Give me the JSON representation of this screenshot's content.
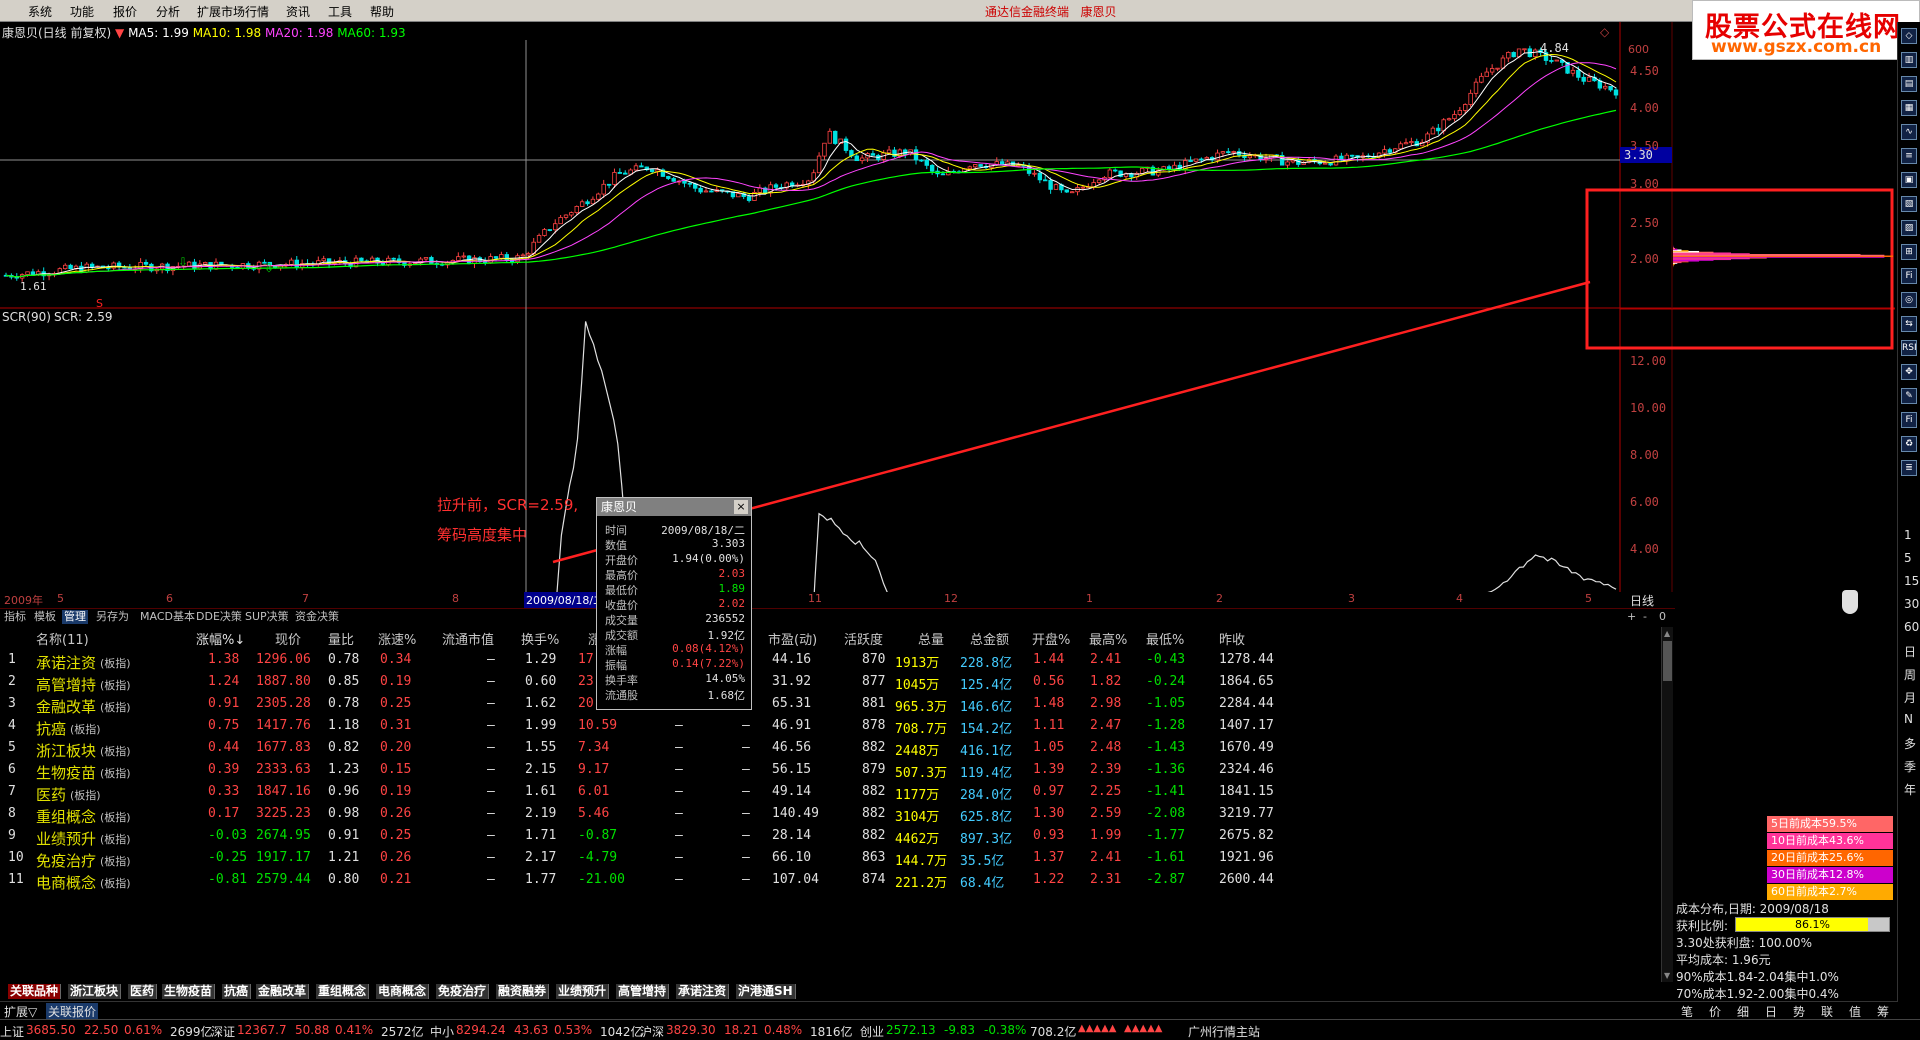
{
  "menu": [
    "系统",
    "功能",
    "报价",
    "分析",
    "扩展市场行情",
    "资讯",
    "工具",
    "帮助"
  ],
  "app_title": "通达信金融终端",
  "window_stock": "康恩贝",
  "logo": {
    "line1": "股票公式在线网",
    "line2": "www.gszx.com.cn"
  },
  "stock_line": {
    "name": "康恩贝(日线 前复权)",
    "ma5": "MA5: 1.99",
    "ma10": "MA10: 1.98",
    "ma20": "MA20: 1.98",
    "ma60": "MA60: 1.93"
  },
  "colors": {
    "ma5": "#ffffff",
    "ma10": "#ffff00",
    "ma20": "#ff44ff",
    "ma60": "#00ff00",
    "up": "#ff4444",
    "down": "#00e0e0",
    "annotation": "#ff2020"
  },
  "price_axis": [
    "4.50",
    "4.00",
    "3.50",
    "3.00",
    "2.50",
    "2.00"
  ],
  "price_highlight": "3.30",
  "top_price_label": "600",
  "peak_label": "4.84",
  "low_label": "1.61",
  "scr_line": {
    "label": "SCR(90)",
    "value": "SCR: 2.59"
  },
  "scr_axis": [
    "12.00",
    "10.00",
    "8.00",
    "6.00",
    "4.00"
  ],
  "annotation": {
    "line1": "拉升前，SCR=2.59,",
    "line2": "筹码高度集中"
  },
  "date_labels": [
    "2009年",
    "5",
    "6",
    "7",
    "8",
    "2009/08/18/二",
    "11",
    "12",
    "1",
    "2",
    "3",
    "4",
    "5"
  ],
  "period_label": "日线",
  "tabs_top": [
    "指标",
    "模板",
    "管理",
    "另存为",
    "MACD基本",
    "DDE决策",
    "SUP决策",
    "资金决策"
  ],
  "active_tab_top": "管理",
  "table": {
    "headers": [
      "名称(11)",
      "涨幅%↓",
      "现价",
      "量比",
      "涨速%",
      "流通市值",
      "换手%",
      "涨",
      "",
      "",
      "市盈(动)",
      "活跃度",
      "总量",
      "总金额",
      "开盘%",
      "最高%",
      "最低%",
      "昨收"
    ],
    "rows": [
      {
        "no": "1",
        "name": "承诺注资",
        "tag": "(板指)",
        "chg": "1.38",
        "price": "1296.06",
        "vr": "0.78",
        "spd": "0.34",
        "mcap": "–",
        "turn": "1.29",
        "x1": "17",
        "x2": "",
        "x3": "",
        "pe": "44.16",
        "act": "870",
        "vol": "1913万",
        "amt": "228.8亿",
        "open": "1.44",
        "high": "2.41",
        "low": "-0.43",
        "prev": "1278.44"
      },
      {
        "no": "2",
        "name": "高管增持",
        "tag": "(板指)",
        "chg": "1.24",
        "price": "1887.80",
        "vr": "0.85",
        "spd": "0.19",
        "mcap": "–",
        "turn": "0.60",
        "x1": "23",
        "x2": "",
        "x3": "",
        "pe": "31.92",
        "act": "877",
        "vol": "1045万",
        "amt": "125.4亿",
        "open": "0.56",
        "high": "1.82",
        "low": "-0.24",
        "prev": "1864.65"
      },
      {
        "no": "3",
        "name": "金融改革",
        "tag": "(板指)",
        "chg": "0.91",
        "price": "2305.28",
        "vr": "0.78",
        "spd": "0.25",
        "mcap": "–",
        "turn": "1.62",
        "x1": "20",
        "x2": "",
        "x3": "",
        "pe": "65.31",
        "act": "881",
        "vol": "965.3万",
        "amt": "146.6亿",
        "open": "1.48",
        "high": "2.98",
        "low": "-1.05",
        "prev": "2284.44"
      },
      {
        "no": "4",
        "name": "抗癌",
        "tag": "(板指)",
        "chg": "0.75",
        "price": "1417.76",
        "vr": "1.18",
        "spd": "0.31",
        "mcap": "–",
        "turn": "1.99",
        "x1": "10.59",
        "x2": "–",
        "x3": "–",
        "pe": "46.91",
        "act": "878",
        "vol": "708.7万",
        "amt": "154.2亿",
        "open": "1.11",
        "high": "2.47",
        "low": "-1.28",
        "prev": "1407.17"
      },
      {
        "no": "5",
        "name": "浙江板块",
        "tag": "(板指)",
        "chg": "0.44",
        "price": "1677.83",
        "vr": "0.82",
        "spd": "0.20",
        "mcap": "–",
        "turn": "1.55",
        "x1": "7.34",
        "x2": "–",
        "x3": "–",
        "pe": "46.56",
        "act": "882",
        "vol": "2448万",
        "amt": "416.1亿",
        "open": "1.05",
        "high": "2.48",
        "low": "-1.43",
        "prev": "1670.49"
      },
      {
        "no": "6",
        "name": "生物疫苗",
        "tag": "(板指)",
        "chg": "0.39",
        "price": "2333.63",
        "vr": "1.23",
        "spd": "0.15",
        "mcap": "–",
        "turn": "2.15",
        "x1": "9.17",
        "x2": "–",
        "x3": "–",
        "pe": "56.15",
        "act": "879",
        "vol": "507.3万",
        "amt": "119.4亿",
        "open": "1.39",
        "high": "2.39",
        "low": "-1.36",
        "prev": "2324.46"
      },
      {
        "no": "7",
        "name": "医药",
        "tag": "(板指)",
        "chg": "0.33",
        "price": "1847.16",
        "vr": "0.96",
        "spd": "0.19",
        "mcap": "–",
        "turn": "1.61",
        "x1": "6.01",
        "x2": "–",
        "x3": "–",
        "pe": "49.14",
        "act": "882",
        "vol": "1177万",
        "amt": "284.0亿",
        "open": "0.97",
        "high": "2.25",
        "low": "-1.41",
        "prev": "1841.15"
      },
      {
        "no": "8",
        "name": "重组概念",
        "tag": "(板指)",
        "chg": "0.17",
        "price": "3225.23",
        "vr": "0.98",
        "spd": "0.26",
        "mcap": "–",
        "turn": "2.19",
        "x1": "5.46",
        "x2": "–",
        "x3": "–",
        "pe": "140.49",
        "act": "882",
        "vol": "3104万",
        "amt": "625.8亿",
        "open": "1.30",
        "high": "2.59",
        "low": "-2.08",
        "prev": "3219.77"
      },
      {
        "no": "9",
        "name": "业绩预升",
        "tag": "(板指)",
        "chg": "-0.03",
        "price": "2674.95",
        "vr": "0.91",
        "spd": "0.25",
        "mcap": "–",
        "turn": "1.71",
        "x1": "-0.87",
        "x2": "–",
        "x3": "–",
        "pe": "28.14",
        "act": "882",
        "vol": "4462万",
        "amt": "897.3亿",
        "open": "0.93",
        "high": "1.99",
        "low": "-1.77",
        "prev": "2675.82"
      },
      {
        "no": "10",
        "name": "免疫治疗",
        "tag": "(板指)",
        "chg": "-0.25",
        "price": "1917.17",
        "vr": "1.21",
        "spd": "0.26",
        "mcap": "–",
        "turn": "2.17",
        "x1": "-4.79",
        "x2": "–",
        "x3": "–",
        "pe": "66.10",
        "act": "863",
        "vol": "144.7万",
        "amt": "35.5亿",
        "open": "1.37",
        "high": "2.41",
        "low": "-1.61",
        "prev": "1921.96"
      },
      {
        "no": "11",
        "name": "电商概念",
        "tag": "(板指)",
        "chg": "-0.81",
        "price": "2579.44",
        "vr": "0.80",
        "spd": "0.21",
        "mcap": "–",
        "turn": "1.77",
        "x1": "-21.00",
        "x2": "–",
        "x3": "–",
        "pe": "107.04",
        "act": "874",
        "vol": "221.2万",
        "amt": "68.4亿",
        "open": "1.22",
        "high": "2.31",
        "low": "-2.87",
        "prev": "2600.44"
      }
    ]
  },
  "popup": {
    "title": "康恩贝",
    "close": "×",
    "rows": [
      {
        "k": "时间",
        "v": "2009/08/18/二"
      },
      {
        "k": "数值",
        "v": "3.303"
      },
      {
        "k": "开盘价",
        "v": "1.94(0.00%)"
      },
      {
        "k": "最高价",
        "v": "2.03"
      },
      {
        "k": "最低价",
        "v": "1.89"
      },
      {
        "k": "收盘价",
        "v": "2.02"
      },
      {
        "k": "成交量",
        "v": "236552"
      },
      {
        "k": "成交额",
        "v": "1.92亿"
      },
      {
        "k": "涨幅",
        "v": "0.08(4.12%)"
      },
      {
        "k": "振幅",
        "v": "0.14(7.22%)"
      },
      {
        "k": "换手率",
        "v": "14.05%"
      },
      {
        "k": "流通股",
        "v": "1.68亿"
      }
    ]
  },
  "bottom_tabs": [
    "关联品种",
    "浙江板块",
    "医药",
    "生物疫苗",
    "抗癌",
    "金融改革",
    "重组概念",
    "电商概念",
    "免疫治疗",
    "融资融券",
    "业绩预升",
    "高管增持",
    "承诺注资",
    "沪港通SH"
  ],
  "status_tabs": [
    "扩展",
    "关联报价"
  ],
  "status_tabs_caret": "▽",
  "index_bar": [
    {
      "name": "上证",
      "val": "3685.50",
      "chg": "22.50",
      "pct": "0.61%",
      "amt": "2699亿"
    },
    {
      "name": "深证",
      "val": "12367.7",
      "chg": "50.88",
      "pct": "0.41%",
      "amt": "2572亿"
    },
    {
      "name": "中小",
      "val": "8294.24",
      "chg": "43.63",
      "pct": "0.53%",
      "amt": "1042亿"
    },
    {
      "name": "沪深",
      "val": "3829.30",
      "chg": "18.21",
      "pct": "0.48%",
      "amt": "1816亿"
    },
    {
      "name": "创业",
      "val": "2572.13",
      "chg": "-9.83",
      "pct": "-0.38%",
      "amt": "708.2亿"
    }
  ],
  "station": "广州行情主站",
  "cost_legend": [
    {
      "label": "5日前成本59.5%",
      "color": "#ff6666"
    },
    {
      "label": "10日前成本43.6%",
      "color": "#ff3399"
    },
    {
      "label": "20日前成本25.6%",
      "color": "#ff6600"
    },
    {
      "label": "30日前成本12.8%",
      "color": "#cc00cc"
    },
    {
      "label": "60日前成本2.7%",
      "color": "#ffaa00"
    }
  ],
  "cost_info": {
    "date": "成本分布,日期: 2009/08/18",
    "profit_label": "获利比例:",
    "profit_value": "86.1%",
    "line3": "3.30处获利盘: 100.00%",
    "avg": "平均成本: 1.96元",
    "c90": "90%成本1.84-2.04集中1.0%",
    "c70": "70%成本1.92-2.00集中0.4%"
  },
  "right_bottom_tabs": [
    "笔",
    "价",
    "细",
    "日",
    "势",
    "联",
    "值",
    "筹"
  ],
  "side_labels": [
    "1",
    "5",
    "15",
    "30",
    "60",
    "日",
    "周",
    "月",
    "N",
    "多",
    "季",
    "年"
  ],
  "side_icons": [
    "◇",
    "▥",
    "▤",
    "▦",
    "∿",
    "≡",
    "▣",
    "▧",
    "▨",
    "⊞",
    "Fi",
    "◎",
    "⇆",
    "RSI",
    "✥",
    "✎",
    "Fi",
    "♻",
    "≣"
  ]
}
